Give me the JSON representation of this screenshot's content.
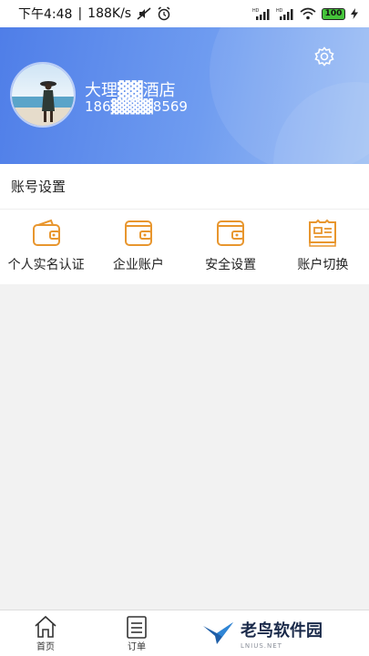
{
  "status_bar": {
    "time": "下午4:48",
    "speed": "188K/s",
    "battery": "100"
  },
  "profile": {
    "hotel_name": "大理▓▓酒店",
    "phone": "186▓▓▓▓8569"
  },
  "account_section": {
    "title": "账号设置",
    "items": [
      {
        "label": "个人实名认证",
        "icon": "wallet-icon"
      },
      {
        "label": "企业账户",
        "icon": "wallet-icon"
      },
      {
        "label": "安全设置",
        "icon": "wallet-icon"
      },
      {
        "label": "账户切换",
        "icon": "receipt-icon"
      }
    ]
  },
  "bottom_nav": {
    "items": [
      {
        "label": "首页",
        "icon": "home-icon"
      },
      {
        "label": "订单",
        "icon": "clipboard-icon"
      }
    ]
  },
  "watermark": {
    "title": "老鸟软件园",
    "subtitle": "LNIUS.NET"
  },
  "colors": {
    "header_start": "#4f7ee8",
    "header_end": "#9fc0f4",
    "icon_accent": "#e8962e"
  }
}
